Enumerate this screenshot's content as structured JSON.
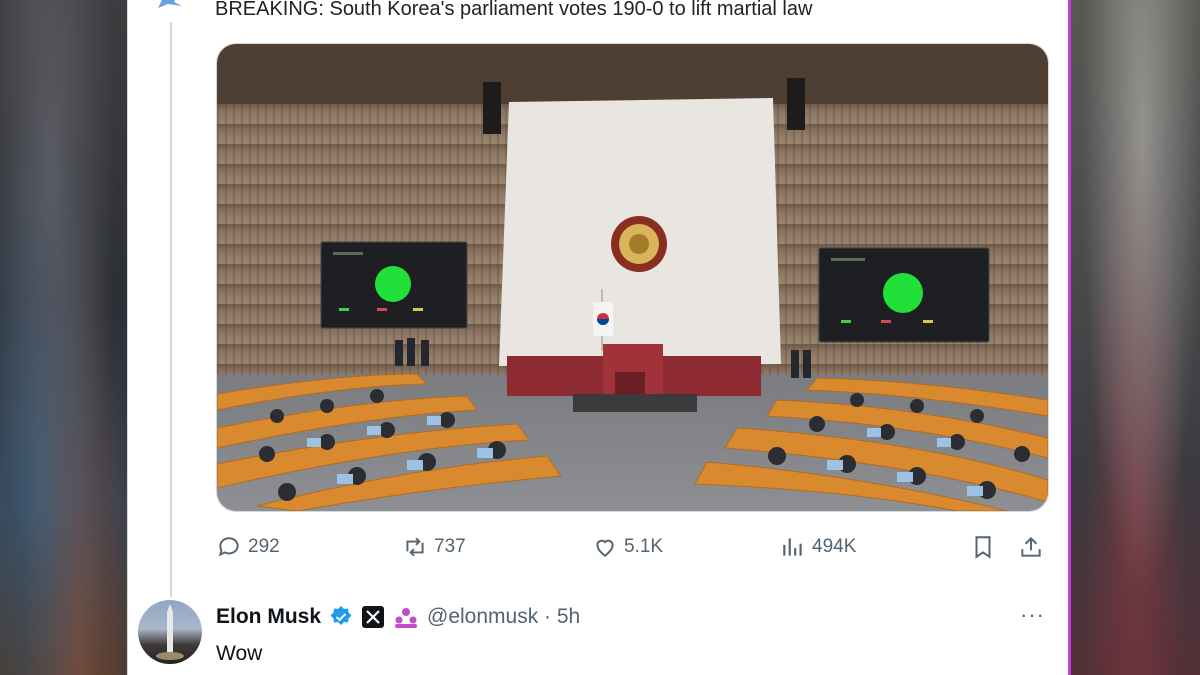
{
  "tweet": {
    "headline": "BREAKING: South Korea's parliament votes 190-0 to lift martial law"
  },
  "metrics": {
    "replies": "292",
    "reposts": "737",
    "likes": "5.1K",
    "views": "494K"
  },
  "reply": {
    "name": "Elon Musk",
    "handle": "@elonmusk · 5h",
    "text": "Wow",
    "more": "···"
  },
  "colors": {
    "verified": "#1d9bf0",
    "affiliate_badge": "#c44cc8",
    "frame_accent": "#c43ed8",
    "icon_gray": "#536471"
  },
  "icons": [
    "reply-icon",
    "repost-icon",
    "like-icon",
    "views-icon",
    "bookmark-icon",
    "share-icon",
    "verified-icon",
    "x-badge-icon",
    "affiliate-icon",
    "more-icon"
  ]
}
